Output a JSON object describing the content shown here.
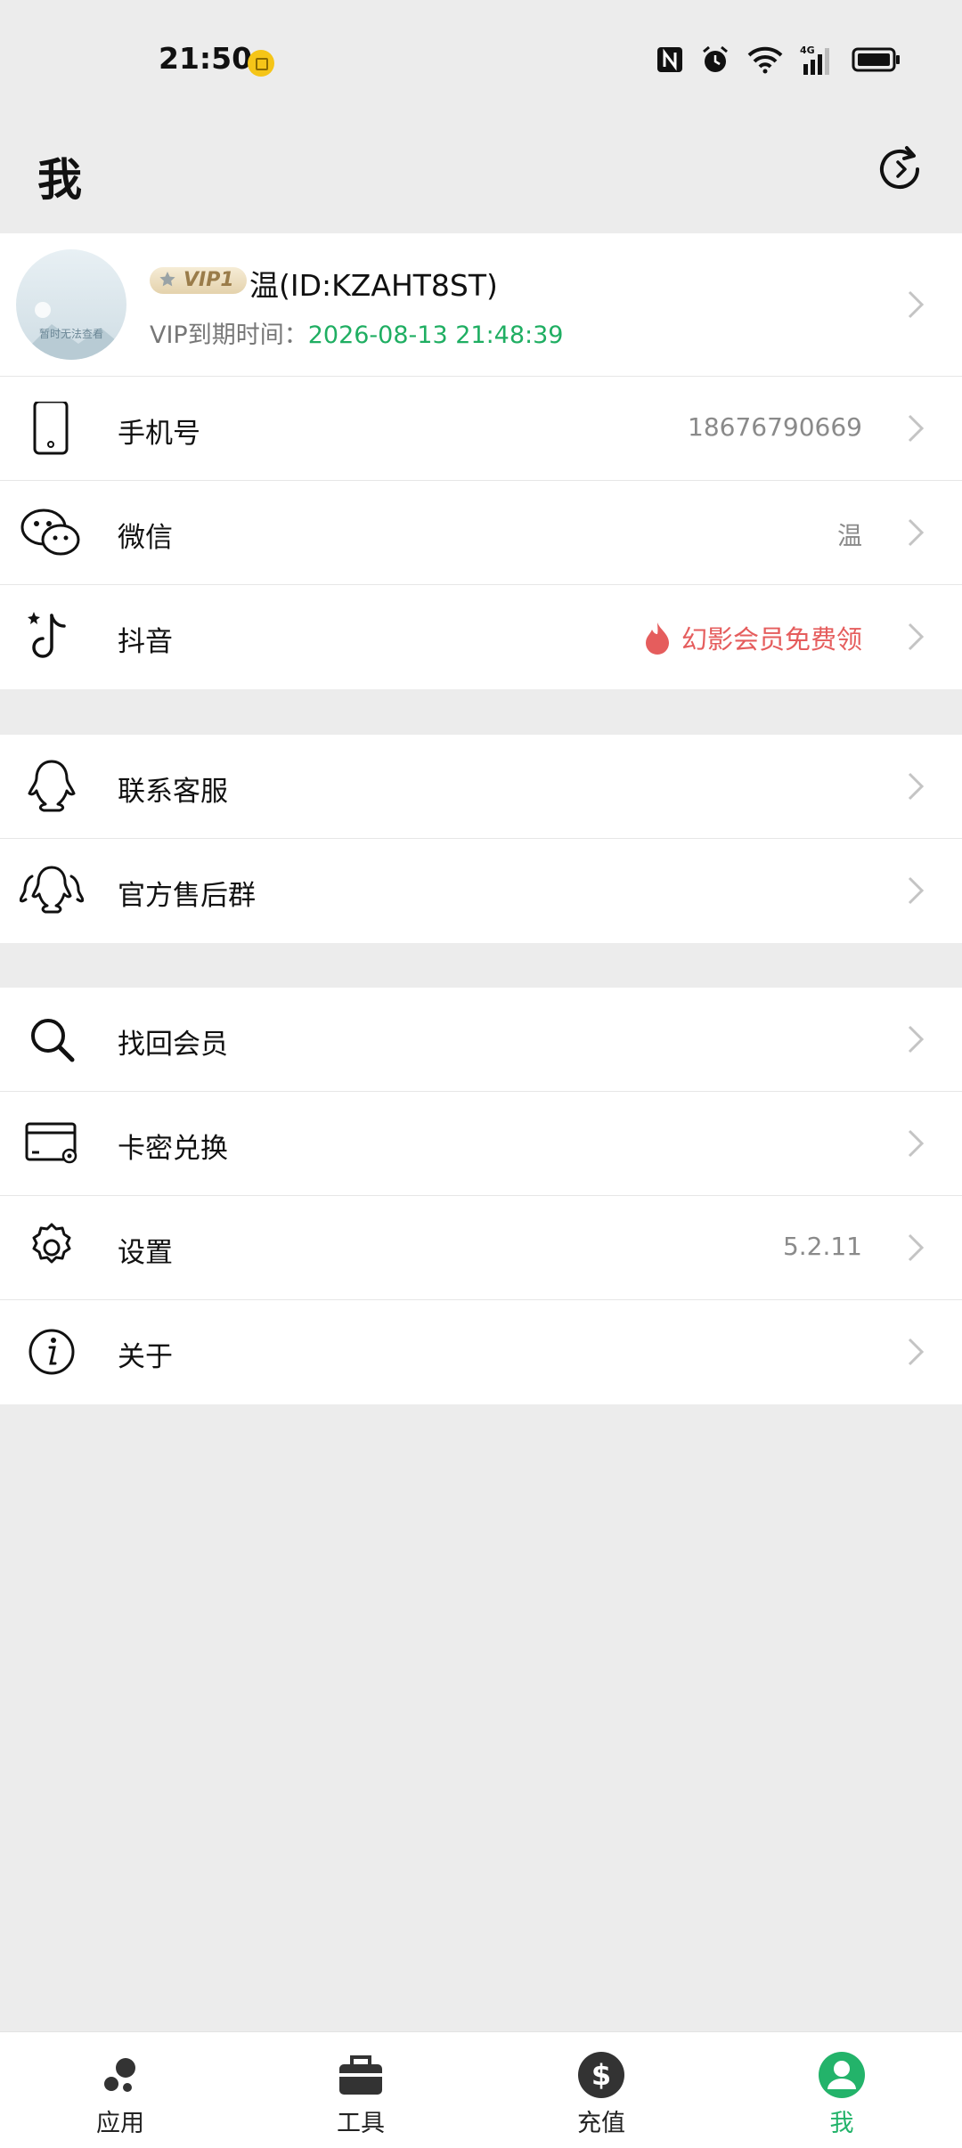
{
  "status_bar": {
    "time": "21:50",
    "icons": [
      "coin-icon",
      "nfc-icon",
      "alarm-icon",
      "wifi-icon",
      "4g-signal-icon",
      "battery-icon"
    ]
  },
  "header": {
    "title": "我",
    "refresh_icon": "refresh-icon"
  },
  "profile": {
    "avatar_text": "暂时无法查看",
    "vip_badge": "VIP1",
    "name": "温(ID:KZAHT8ST)",
    "expire_label": "VIP到期时间：",
    "expire_date": "2026-08-13 21:48:39"
  },
  "account_rows": [
    {
      "label": "手机号",
      "value": "18676790669",
      "icon": "phone-icon"
    },
    {
      "label": "微信",
      "value": "温",
      "icon": "wechat-icon"
    },
    {
      "label": "抖音",
      "promo": "幻影会员免费领",
      "icon": "tiktok-icon"
    }
  ],
  "support_rows": [
    {
      "label": "联系客服",
      "icon": "qq-icon"
    },
    {
      "label": "官方售后群",
      "icon": "qq-group-icon"
    }
  ],
  "misc_rows": [
    {
      "label": "找回会员",
      "icon": "search-icon"
    },
    {
      "label": "卡密兑换",
      "icon": "card-icon"
    },
    {
      "label": "设置",
      "value": "5.2.11",
      "icon": "gear-icon"
    },
    {
      "label": "关于",
      "icon": "info-icon"
    }
  ],
  "tabs": [
    {
      "label": "应用",
      "icon": "apps-icon",
      "active": false
    },
    {
      "label": "工具",
      "icon": "toolbox-icon",
      "active": false
    },
    {
      "label": "充值",
      "icon": "dollar-icon",
      "active": false
    },
    {
      "label": "我",
      "icon": "user-icon",
      "active": true
    }
  ],
  "colors": {
    "accent": "#23b36a",
    "promo": "#e55d5d",
    "background": "#ececec"
  }
}
